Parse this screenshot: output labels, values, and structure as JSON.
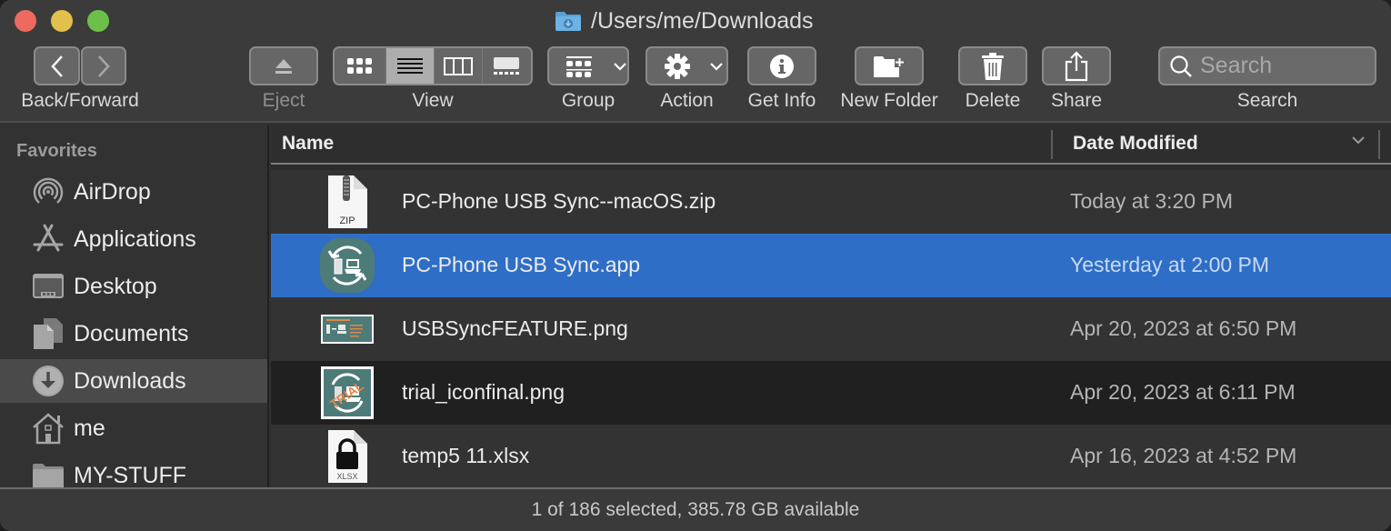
{
  "window": {
    "title": "/Users/me/Downloads"
  },
  "toolbar": {
    "back_forward_label": "Back/Forward",
    "eject_label": "Eject",
    "view_label": "View",
    "view_modes": [
      "icons",
      "list",
      "columns",
      "gallery"
    ],
    "view_selected": "list",
    "group_label": "Group",
    "action_label": "Action",
    "get_info_label": "Get Info",
    "new_folder_label": "New Folder",
    "delete_label": "Delete",
    "share_label": "Share",
    "search_label": "Search",
    "search_placeholder": "Search",
    "search_value": ""
  },
  "sidebar": {
    "section_title": "Favorites",
    "items": [
      {
        "label": "AirDrop",
        "icon": "airdrop-icon",
        "selected": false
      },
      {
        "label": "Applications",
        "icon": "applications-icon",
        "selected": false
      },
      {
        "label": "Desktop",
        "icon": "desktop-icon",
        "selected": false
      },
      {
        "label": "Documents",
        "icon": "documents-icon",
        "selected": false
      },
      {
        "label": "Downloads",
        "icon": "downloads-icon",
        "selected": true
      },
      {
        "label": "me",
        "icon": "home-icon",
        "selected": false
      },
      {
        "label": "MY-STUFF",
        "icon": "folder-icon",
        "selected": false
      }
    ]
  },
  "file_list": {
    "columns": {
      "name": "Name",
      "date_modified": "Date Modified"
    },
    "sort_column": "Date Modified",
    "sort_direction": "descending",
    "rows": [
      {
        "name": "PC-Phone USB Sync--macOS.zip",
        "date": "Today at 3:20 PM",
        "icon": "zip-file-icon",
        "icon_label": "ZIP",
        "selected": false
      },
      {
        "name": "PC-Phone USB Sync.app",
        "date": "Yesterday at 2:00 PM",
        "icon": "app-icon",
        "selected": true
      },
      {
        "name": "USBSyncFEATURE.png",
        "date": "Apr 20, 2023 at 6:50 PM",
        "icon": "image-thumbnail-icon",
        "selected": false
      },
      {
        "name": "trial_iconfinal.png",
        "date": "Apr 20, 2023 at 6:11 PM",
        "icon": "image-thumbnail-icon",
        "thumbnail_text": "TRIAL",
        "selected": false
      },
      {
        "name": "temp5 11.xlsx",
        "date": "Apr 16, 2023 at 4:52 PM",
        "icon": "locked-xlsx-file-icon",
        "icon_label": "XLSX",
        "selected": false
      }
    ]
  },
  "status_bar": {
    "text": "1 of 186 selected, 385.78 GB available"
  },
  "colors": {
    "selection": "#2f6ec6",
    "app_icon_teal": "#4d7b78",
    "close": "#ec6a5e",
    "minimize": "#e3c04b",
    "maximize": "#6cc04a"
  }
}
